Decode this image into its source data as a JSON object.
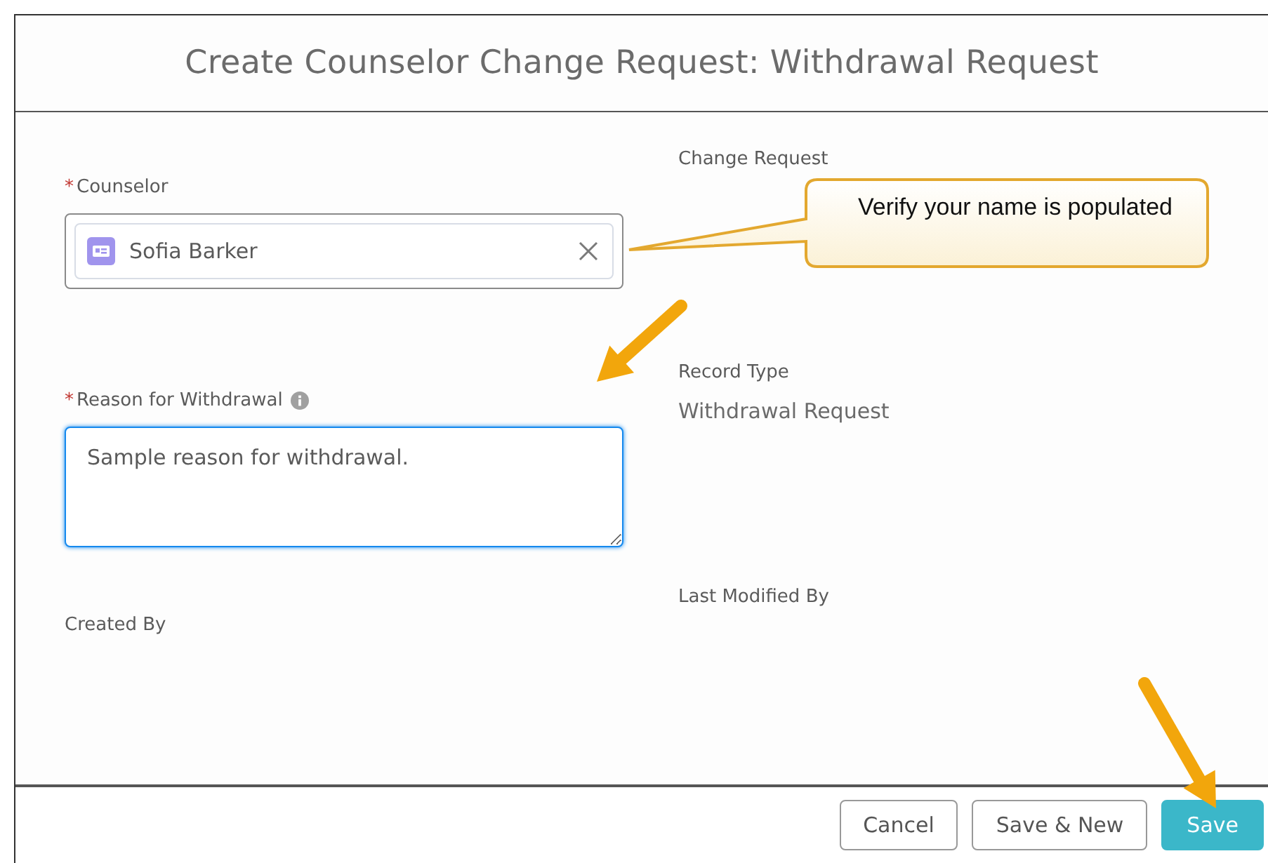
{
  "dialog": {
    "title": "Create Counselor Change Request: Withdrawal Request"
  },
  "fields": [
    {
      "kind": "lookup",
      "label": "Counselor",
      "required_mark": "*",
      "value": "Sofia Barker"
    },
    {
      "kind": "readonly",
      "label": "Change Request"
    },
    {
      "kind": "textarea",
      "label": "Reason for Withdrawal",
      "required_mark": "*",
      "info": true,
      "value": "Sample reason for withdrawal."
    },
    {
      "kind": "readonly",
      "label": "Record Type",
      "value": "Withdrawal Request"
    },
    {
      "kind": "readonly",
      "label": "Created By"
    },
    {
      "kind": "readonly",
      "label": "Last Modified By"
    }
  ],
  "callout": {
    "text": "Verify your name is populated"
  },
  "buttons": [
    {
      "label": "Cancel",
      "kind": "neutral"
    },
    {
      "label": "Save & New",
      "kind": "neutral"
    },
    {
      "label": "Save",
      "kind": "brand"
    }
  ]
}
